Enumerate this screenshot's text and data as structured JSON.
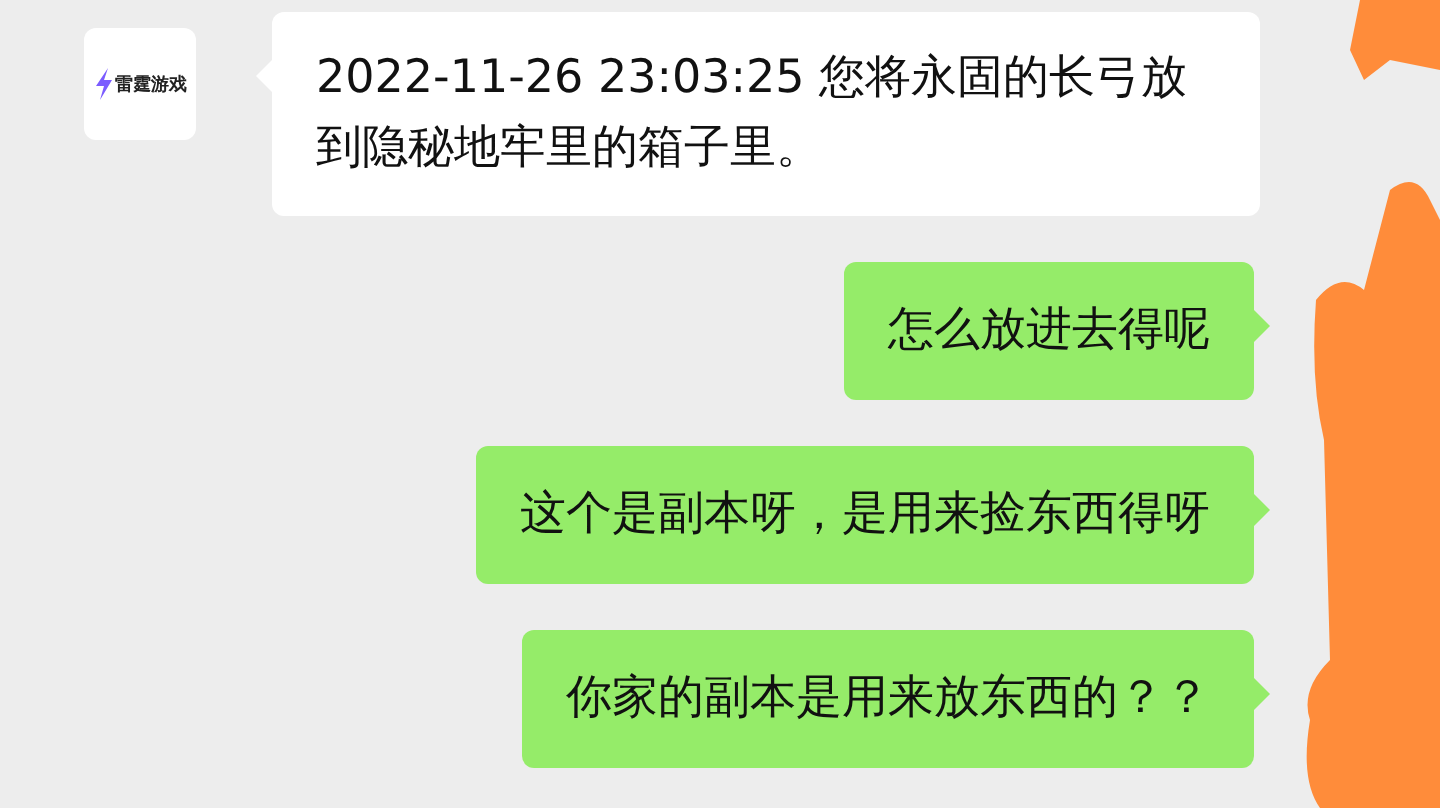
{
  "messages": [
    {
      "kind": "incoming",
      "avatar_label": "雷霆游戏",
      "text": "2022-11-26 23:03:25  您将永固的长弓放到隐秘地牢里的箱子里。"
    },
    {
      "kind": "outgoing",
      "text": "怎么放进去得呢"
    },
    {
      "kind": "outgoing",
      "text": "这个是副本呀，是用来捡东西得呀"
    },
    {
      "kind": "outgoing",
      "text": "你家的副本是用来放东西的？？"
    }
  ]
}
